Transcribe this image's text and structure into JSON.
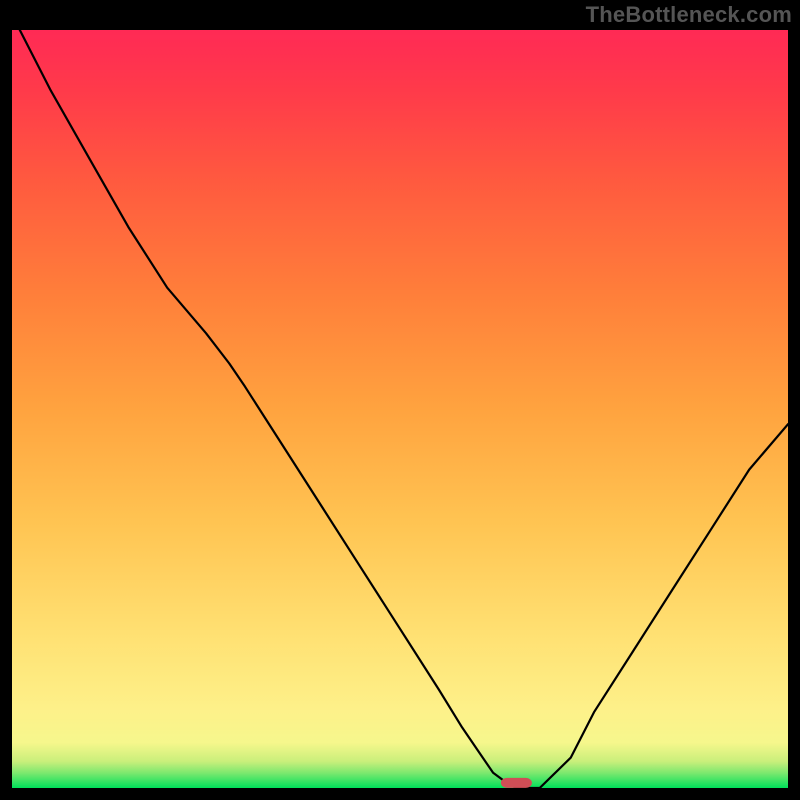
{
  "watermark": "TheBottleneck.com",
  "chart_data": {
    "type": "line",
    "title": "",
    "xlabel": "",
    "ylabel": "",
    "xlim": [
      0,
      100
    ],
    "ylim": [
      0,
      100
    ],
    "grid": false,
    "legend": false,
    "series": [
      {
        "name": "bottleneck-curve",
        "x": [
          1,
          5,
          10,
          15,
          20,
          25,
          28,
          30,
          35,
          40,
          45,
          50,
          55,
          58,
          60,
          62,
          64,
          65,
          68,
          72,
          75,
          80,
          85,
          90,
          95,
          100
        ],
        "y": [
          100,
          92,
          83,
          74,
          66,
          60,
          56,
          53,
          45,
          37,
          29,
          21,
          13,
          8,
          5,
          2,
          0.5,
          0,
          0,
          4,
          10,
          18,
          26,
          34,
          42,
          48
        ]
      }
    ],
    "optimum_marker": {
      "x": 65,
      "width": 4,
      "y": 0,
      "height": 1.2
    },
    "gradient_stops": [
      {
        "offset": 0.0,
        "color": "#00e05a"
      },
      {
        "offset": 0.02,
        "color": "#7de86f"
      },
      {
        "offset": 0.035,
        "color": "#c9ef7b"
      },
      {
        "offset": 0.06,
        "color": "#f6f78c"
      },
      {
        "offset": 0.1,
        "color": "#fdf18a"
      },
      {
        "offset": 0.2,
        "color": "#ffe173"
      },
      {
        "offset": 0.35,
        "color": "#ffc452"
      },
      {
        "offset": 0.5,
        "color": "#ffa33f"
      },
      {
        "offset": 0.65,
        "color": "#ff7f3a"
      },
      {
        "offset": 0.8,
        "color": "#ff5a3f"
      },
      {
        "offset": 0.92,
        "color": "#ff3a4a"
      },
      {
        "offset": 1.0,
        "color": "#ff2a55"
      }
    ]
  }
}
